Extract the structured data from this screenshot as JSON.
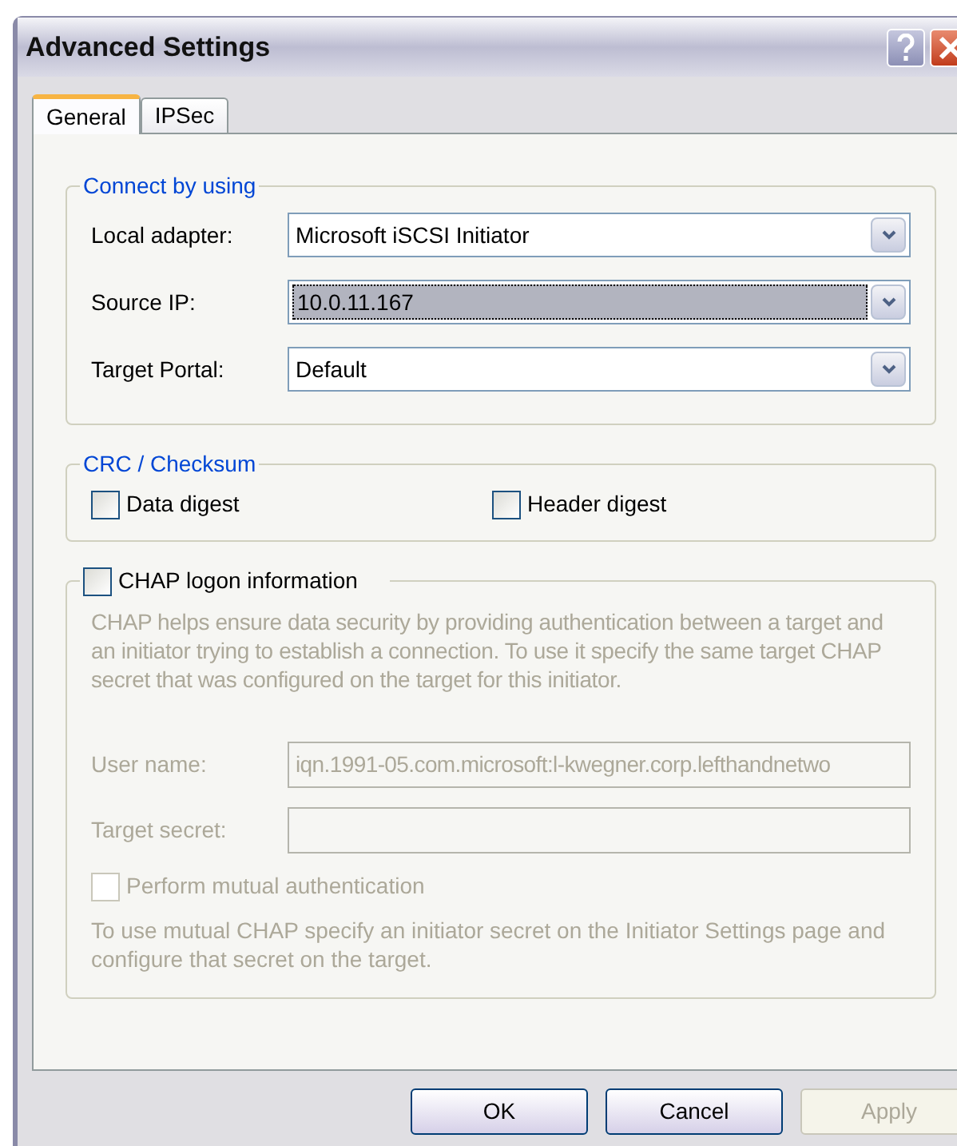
{
  "window": {
    "title": "Advanced Settings"
  },
  "tabs": [
    {
      "label": "General",
      "selected": true
    },
    {
      "label": "IPSec",
      "selected": false
    }
  ],
  "connect_group": {
    "title": "Connect by using",
    "fields": [
      {
        "label": "Local adapter:",
        "value": "Microsoft iSCSI Initiator",
        "focused": false
      },
      {
        "label": "Source IP:",
        "value": "10.0.11.167",
        "focused": true
      },
      {
        "label": "Target Portal:",
        "value": "Default",
        "focused": false
      }
    ]
  },
  "crc_group": {
    "title": "CRC / Checksum",
    "options": [
      {
        "label": "Data digest",
        "checked": false
      },
      {
        "label": "Header digest",
        "checked": false
      }
    ]
  },
  "chap_group": {
    "title": "CHAP logon information",
    "checked": false,
    "disabled": true,
    "description": "CHAP helps ensure data security by providing authentication between a target and an initiator trying to establish a connection. To use it specify the same target CHAP secret that was configured on the target for this initiator.",
    "fields": [
      {
        "label": "User name:",
        "value": "iqn.1991-05.com.microsoft:l-kwegner.corp.lefthandnetwo"
      },
      {
        "label": "Target secret:"
      }
    ],
    "mutual": {
      "label": "Perform mutual authentication",
      "checked": false
    },
    "note": "To use mutual CHAP specify an initiator secret on the Initiator Settings page and configure that secret on the target."
  },
  "buttons": [
    {
      "label": "OK",
      "disabled": false
    },
    {
      "label": "Cancel",
      "disabled": false
    },
    {
      "label": "Apply",
      "disabled": true
    }
  ]
}
